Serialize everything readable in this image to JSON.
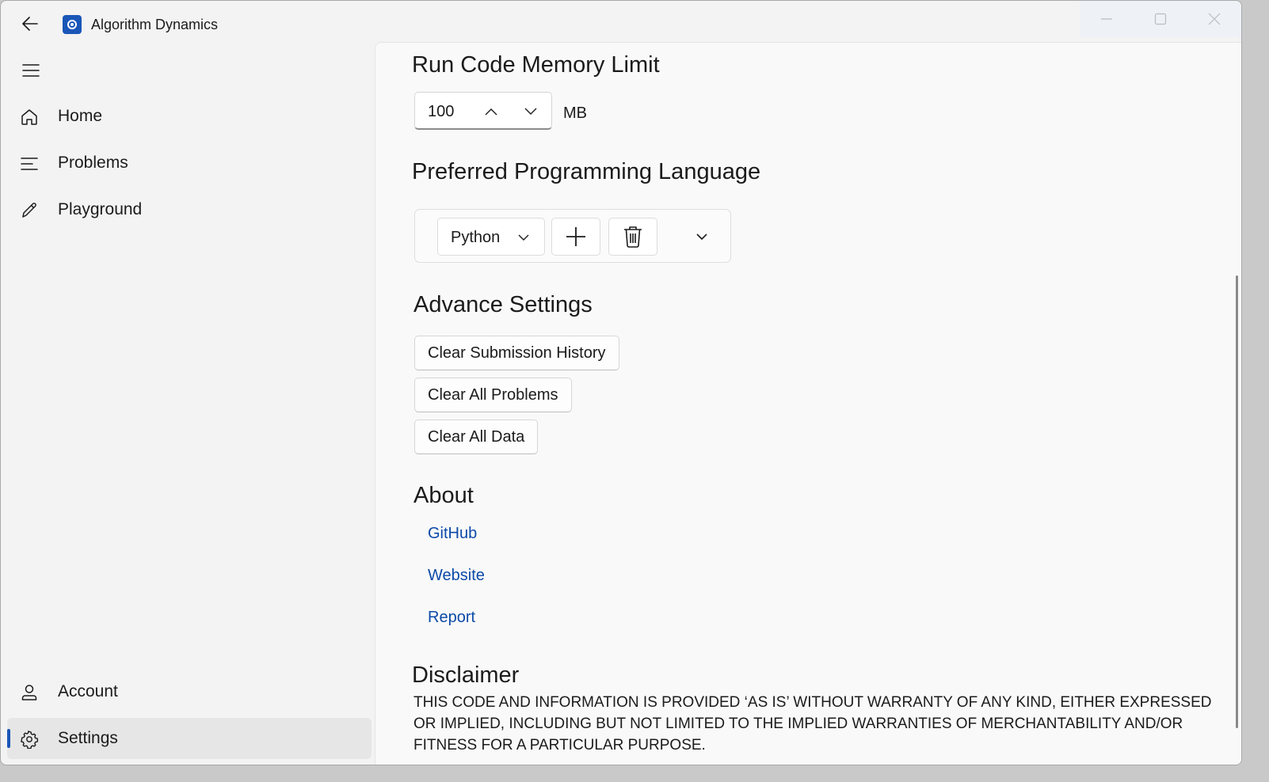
{
  "window": {
    "title": "Algorithm Dynamics"
  },
  "nav": {
    "items": [
      {
        "label": "Home",
        "icon": "home-icon"
      },
      {
        "label": "Problems",
        "icon": "list-icon"
      },
      {
        "label": "Playground",
        "icon": "pencil-icon"
      }
    ],
    "footer_items": [
      {
        "label": "Account",
        "icon": "person-icon"
      },
      {
        "label": "Settings",
        "icon": "gear-icon",
        "selected": true
      }
    ]
  },
  "settings": {
    "memory": {
      "heading": "Run Code Memory Limit",
      "value": "100",
      "unit": "MB"
    },
    "language": {
      "heading": "Preferred Programming Language",
      "selected": "Python"
    },
    "advance": {
      "heading": "Advance Settings",
      "buttons": [
        "Clear Submission History",
        "Clear All Problems",
        "Clear All Data"
      ]
    },
    "about": {
      "heading": "About",
      "links": [
        "GitHub",
        "Website",
        "Report"
      ]
    },
    "disclaimer": {
      "heading": "Disclaimer",
      "text": "THIS CODE AND INFORMATION IS PROVIDED ‘AS IS’ WITHOUT WARRANTY OF ANY KIND, EITHER EXPRESSED OR IMPLIED, INCLUDING BUT NOT LIMITED TO THE IMPLIED WARRANTIES OF MERCHANTABILITY AND/OR FITNESS FOR A PARTICULAR PURPOSE."
    }
  },
  "colors": {
    "accent": "#1a56b8",
    "link": "#0c4aa8",
    "background": "#f3f3f3"
  }
}
